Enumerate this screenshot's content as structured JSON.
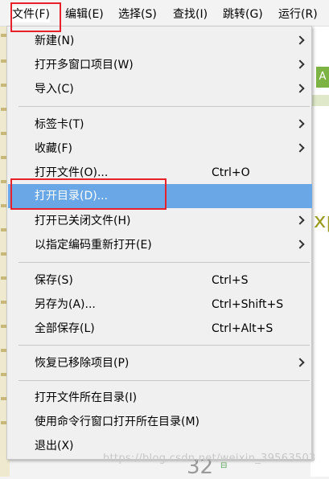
{
  "menubar": {
    "items": [
      {
        "label": "文件(F)"
      },
      {
        "label": "编辑(E)"
      },
      {
        "label": "选择(S)"
      },
      {
        "label": "查找(I)"
      },
      {
        "label": "跳转(G)"
      },
      {
        "label": "运行(R)"
      }
    ]
  },
  "menu": {
    "items": [
      {
        "label": "新建(N)",
        "shortcut": "",
        "submenu": true
      },
      {
        "label": "打开多窗口项目(W)",
        "shortcut": "",
        "submenu": true
      },
      {
        "label": "导入(C)",
        "shortcut": "",
        "submenu": true
      },
      {
        "label": "标签卡(T)",
        "shortcut": "",
        "submenu": true
      },
      {
        "label": "收藏(F)",
        "shortcut": "",
        "submenu": true
      },
      {
        "label": "打开文件(O)...",
        "shortcut": "Ctrl+O",
        "submenu": false
      },
      {
        "label": "打开目录(D)...",
        "shortcut": "",
        "submenu": false
      },
      {
        "label": "打开已关闭文件(H)",
        "shortcut": "",
        "submenu": true
      },
      {
        "label": "以指定编码重新打开(E)",
        "shortcut": "",
        "submenu": true
      },
      {
        "label": "保存(S)",
        "shortcut": "Ctrl+S",
        "submenu": false
      },
      {
        "label": "另存为(A)...",
        "shortcut": "Ctrl+Shift+S",
        "submenu": false
      },
      {
        "label": "全部保存(L)",
        "shortcut": "Ctrl+Alt+S",
        "submenu": false
      },
      {
        "label": "恢复已移除项目(P)",
        "shortcut": "",
        "submenu": true
      },
      {
        "label": "打开文件所在目录(I)",
        "shortcut": "",
        "submenu": false
      },
      {
        "label": "使用命令行窗口打开所在目录(M)",
        "shortcut": "",
        "submenu": false
      },
      {
        "label": "退出(X)",
        "shortcut": "",
        "submenu": false
      }
    ],
    "selected_item": "打开目录(D)..."
  },
  "background": {
    "tag": "A",
    "partial_text": "xp",
    "line_number": "32"
  },
  "watermark": "https://blog.csdn.net/weixin_39563503",
  "colors": {
    "highlight_border": "#e8202a",
    "selected_bg": "#6aa7e6",
    "menu_bg": "#f0f0f0"
  }
}
